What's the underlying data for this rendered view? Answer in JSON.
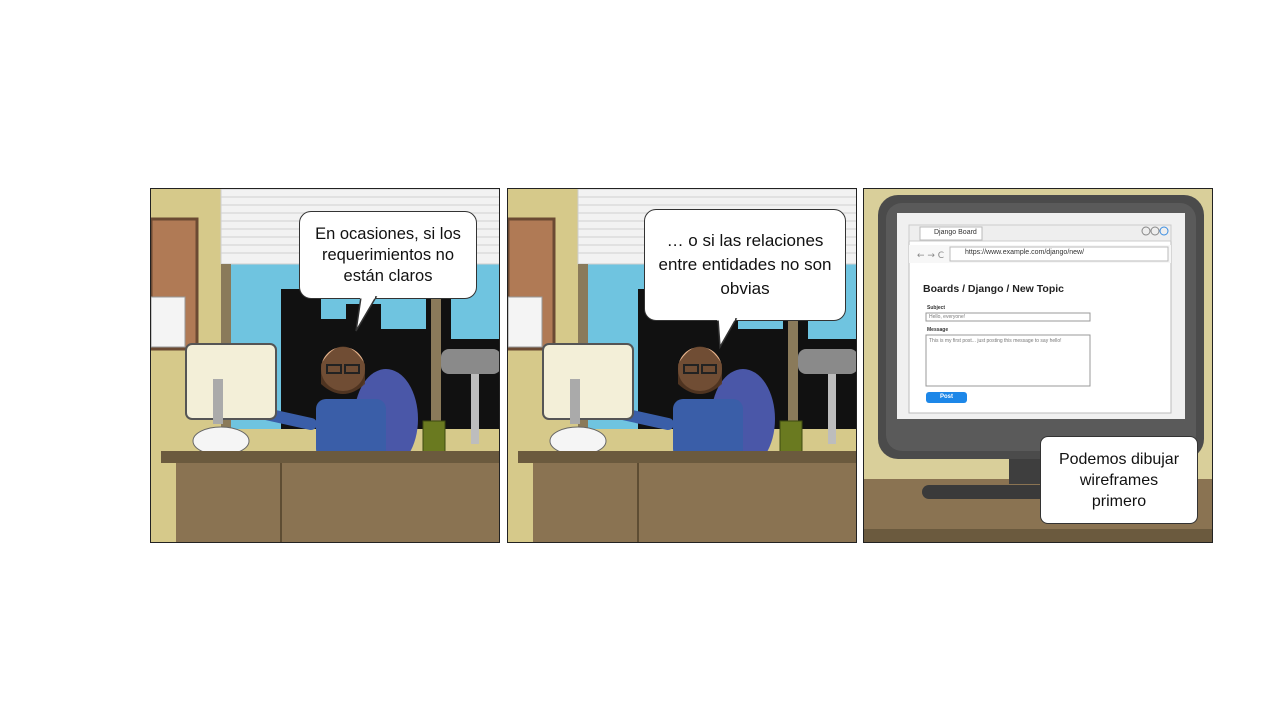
{
  "panels": [
    {
      "caption": "En ocasiones, si los requerimientos no están claros"
    },
    {
      "caption": "… o si las relaciones entre entidades no son obvias"
    },
    {
      "caption": "Podemos dibujar wireframes primero"
    }
  ],
  "wireframe": {
    "tab_label": "Django Board",
    "url": "https://www.example.com/django/new/",
    "heading": "Boards / Django / New Topic",
    "subject_label": "Subject",
    "subject_value": "Hello, everyone!",
    "message_label": "Message",
    "message_value": "This is my first post... just posting this message to say hello!",
    "post_button": "Post"
  },
  "colors": {
    "wall": "#d6c98a",
    "sky": "#6fc4e0",
    "desk": "#8a7352",
    "shirt": "#3a5ea8",
    "button": "#1d87e8"
  }
}
